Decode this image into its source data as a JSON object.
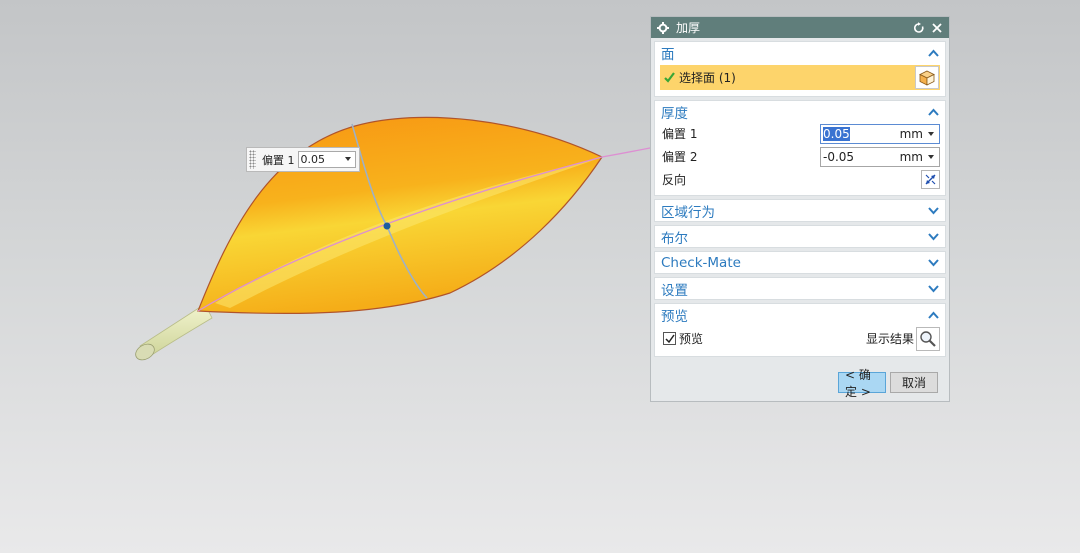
{
  "graphics": {
    "float_input": {
      "label": "偏置 1",
      "value": "0.05"
    }
  },
  "dialog": {
    "title": "加厚",
    "sections": {
      "face": {
        "title": "面",
        "select_label": "选择面 (1)"
      },
      "thickness": {
        "title": "厚度",
        "offset1": {
          "label": "偏置 1",
          "value": "0.05",
          "unit": "mm"
        },
        "offset2": {
          "label": "偏置 2",
          "value": "-0.05",
          "unit": "mm"
        },
        "reverse": {
          "label": "反向"
        }
      },
      "region": {
        "title": "区域行为"
      },
      "boolean": {
        "title": "布尔"
      },
      "checkmate": {
        "title": "Check-Mate"
      },
      "settings": {
        "title": "设置"
      },
      "preview": {
        "title": "预览",
        "checkbox_label": "预览",
        "show_result_label": "显示结果"
      }
    },
    "ok_label": "< 确定 >",
    "cancel_label": "取消"
  },
  "colors": {
    "titlebar": "#607e7b",
    "section_header": "#2d7bbf",
    "selection_highlight": "#fdd46b",
    "leaf_orange": "#f7a11a",
    "leaf_yellow": "#f8df3a",
    "ok_button": "#aad7f3"
  },
  "icons": [
    "gear-icon",
    "reset-icon",
    "close-icon",
    "chevron-up-icon",
    "chevron-down-icon",
    "checkmark-icon",
    "cube-select-icon",
    "reverse-direction-icon",
    "magnifier-icon"
  ]
}
